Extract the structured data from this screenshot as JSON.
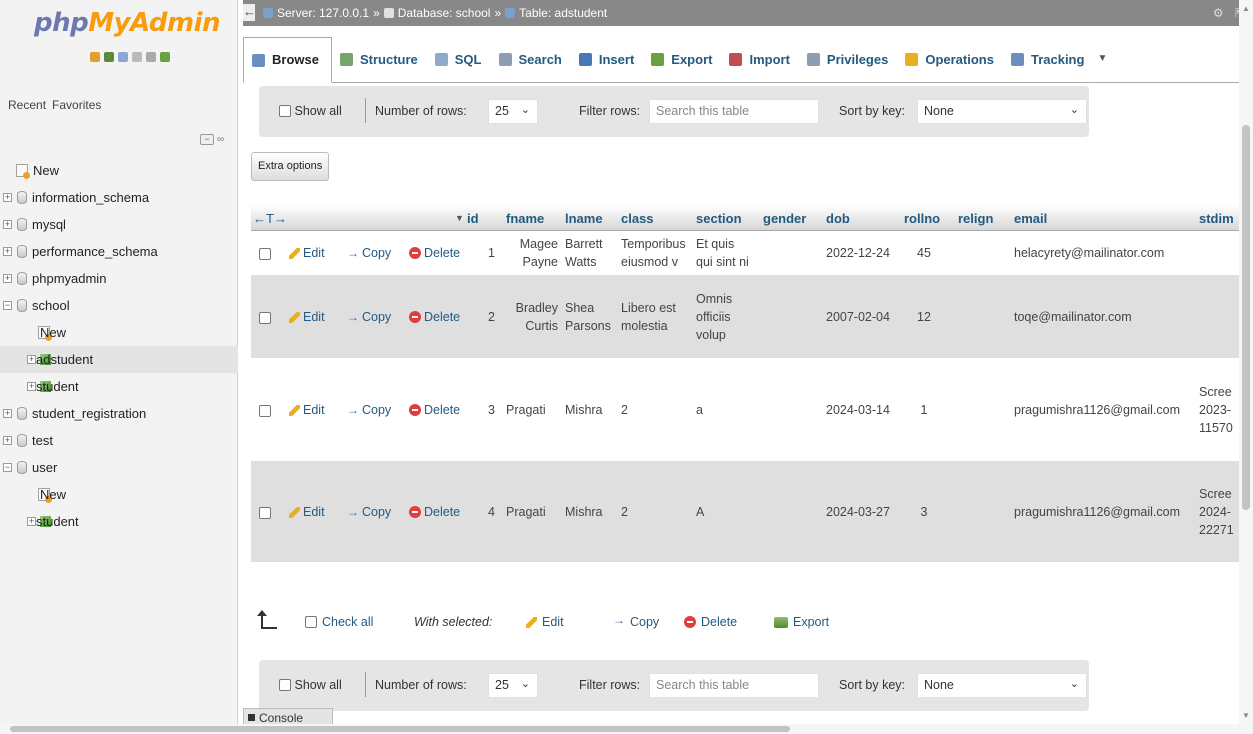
{
  "logo": {
    "php": "php",
    "myadmin": "MyAdmin"
  },
  "nav": {
    "tabs": [
      "Recent",
      "Favorites"
    ],
    "tree": [
      {
        "label": "New",
        "type": "new",
        "level": 0
      },
      {
        "label": "information_schema",
        "type": "db",
        "level": 0
      },
      {
        "label": "mysql",
        "type": "db",
        "level": 0
      },
      {
        "label": "performance_schema",
        "type": "db",
        "level": 0
      },
      {
        "label": "phpmyadmin",
        "type": "db",
        "level": 0
      },
      {
        "label": "school",
        "type": "db",
        "level": 0
      },
      {
        "label": "New",
        "type": "new",
        "level": 1
      },
      {
        "label": "adstudent",
        "type": "table",
        "level": 1
      },
      {
        "label": "student",
        "type": "table",
        "level": 1
      },
      {
        "label": "student_registration",
        "type": "db",
        "level": 0
      },
      {
        "label": "test",
        "type": "db",
        "level": 0
      },
      {
        "label": "user",
        "type": "db",
        "level": 0
      },
      {
        "label": "New",
        "type": "new",
        "level": 1
      },
      {
        "label": "student",
        "type": "table",
        "level": 1
      }
    ]
  },
  "breadcrumb": {
    "server": "Server: 127.0.0.1",
    "database": "Database: school",
    "table": "Table: adstudent",
    "sep": "»"
  },
  "tabs": [
    {
      "label": "Browse",
      "icon": "browse-icon",
      "color": "#6d8fc0"
    },
    {
      "label": "Structure",
      "icon": "structure-icon",
      "color": "#7aa56a"
    },
    {
      "label": "SQL",
      "icon": "sql-icon",
      "color": "#8fa9c9"
    },
    {
      "label": "Search",
      "icon": "search-icon",
      "color": "#8d9db3"
    },
    {
      "label": "Insert",
      "icon": "insert-icon",
      "color": "#4a78b5"
    },
    {
      "label": "Export",
      "icon": "export-icon",
      "color": "#6aa040"
    },
    {
      "label": "Import",
      "icon": "import-icon",
      "color": "#c05050"
    },
    {
      "label": "Privileges",
      "icon": "privileges-icon",
      "color": "#8d9db3"
    },
    {
      "label": "Operations",
      "icon": "operations-icon",
      "color": "#e8b021"
    },
    {
      "label": "Tracking",
      "icon": "tracking-icon",
      "color": "#6d8fc0"
    }
  ],
  "more_tabs": "▼",
  "navbar": {
    "show_all": "Show all",
    "number_of_rows_label": "Number of rows:",
    "number_of_rows_value": "25",
    "filter_rows_label": "Filter rows:",
    "filter_placeholder": "Search this table",
    "sort_by_key_label": "Sort by key:",
    "sort_by_key_value": "None"
  },
  "extra_options": "Extra options",
  "grid": {
    "columns_toggle": "←T→",
    "sort_indicator": "▼",
    "headers": [
      "id",
      "fname",
      "lname",
      "class",
      "section",
      "gender",
      "dob",
      "rollno",
      "relign",
      "email",
      "stdim"
    ],
    "actions": {
      "edit": "Edit",
      "copy": "Copy",
      "delete": "Delete"
    },
    "rows": [
      {
        "id": "1",
        "fname": [
          "Magee",
          "Payne"
        ],
        "lname": [
          "Barrett",
          "Watts"
        ],
        "class": [
          "Temporibus",
          "eiusmod v"
        ],
        "section": [
          "Et quis",
          "qui sint ni"
        ],
        "gender": "",
        "dob": "2022-12-24",
        "rollno": "45",
        "relign": "",
        "email": "helacyrety@mailinator.com",
        "stdim": []
      },
      {
        "id": "2",
        "fname": [
          "Bradley",
          "Curtis"
        ],
        "lname": [
          "Shea",
          "Parsons"
        ],
        "class": [
          "Libero est",
          "molestia"
        ],
        "section": [
          "Omnis",
          "officiis",
          "volup"
        ],
        "gender": "",
        "dob": "2007-02-04",
        "rollno": "12",
        "relign": "",
        "email": "toqe@mailinator.com",
        "stdim": []
      },
      {
        "id": "3",
        "fname": [
          "Pragati"
        ],
        "lname": [
          "Mishra"
        ],
        "class": [
          "2"
        ],
        "section": [
          "a"
        ],
        "gender": "",
        "dob": "2024-03-14",
        "rollno": "1",
        "relign": "",
        "email": "pragumishra1126@gmail.com",
        "stdim": [
          "Scree",
          "2023-",
          "11570"
        ]
      },
      {
        "id": "4",
        "fname": [
          "Pragati"
        ],
        "lname": [
          "Mishra"
        ],
        "class": [
          "2"
        ],
        "section": [
          "A"
        ],
        "gender": "",
        "dob": "2024-03-27",
        "rollno": "3",
        "relign": "",
        "email": "pragumishra1126@gmail.com",
        "stdim": [
          "Scree",
          "2024-",
          "22271"
        ]
      }
    ]
  },
  "bulk": {
    "check_all": "Check all",
    "with_selected": "With selected:",
    "edit": "Edit",
    "copy": "Copy",
    "delete": "Delete",
    "export": "Export"
  },
  "console": "Console"
}
